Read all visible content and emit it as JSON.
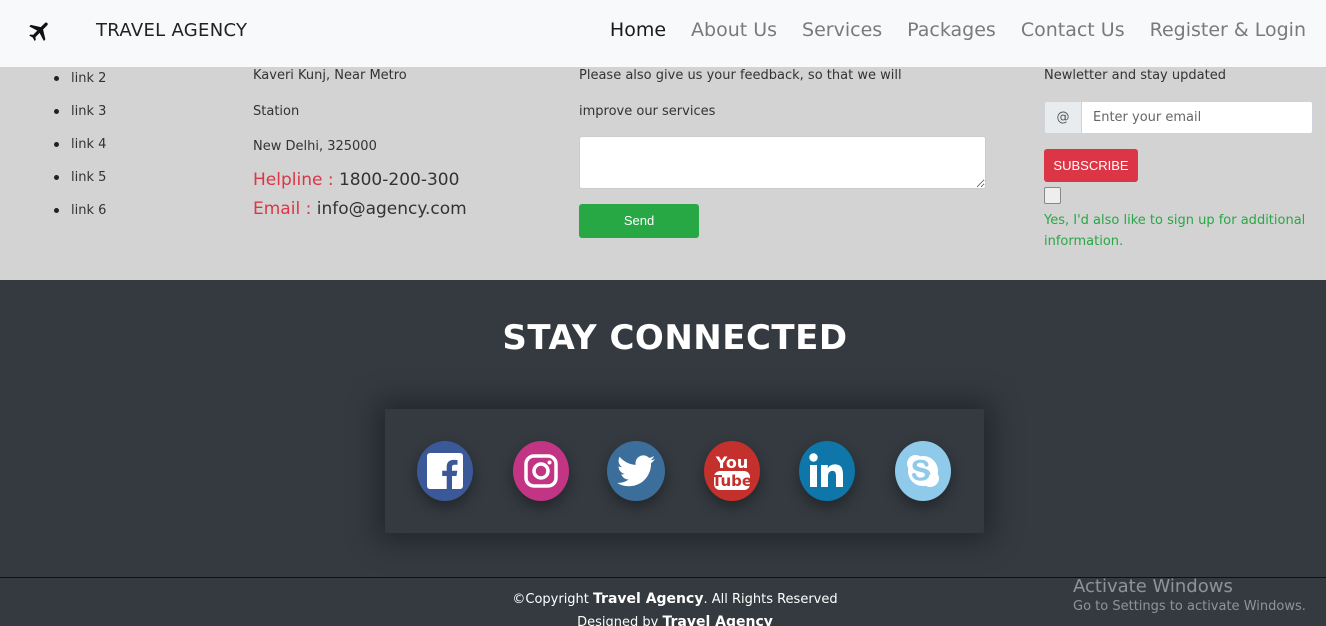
{
  "navbar": {
    "brand": "TRAVEL AGENCY",
    "brand_icon": "airplane-icon",
    "links": [
      {
        "label": "Home",
        "active": true
      },
      {
        "label": "About Us"
      },
      {
        "label": "Services"
      },
      {
        "label": "Packages"
      },
      {
        "label": "Contact Us"
      },
      {
        "label": "Register & Login"
      }
    ]
  },
  "quick_links": [
    "link 2",
    "link 3",
    "link 4",
    "link 5",
    "link 6"
  ],
  "address": {
    "line1": "Kaveri Kunj, Near Metro",
    "line2": "Station",
    "line3": "New Delhi, 325000",
    "helpline_label": "Helpline",
    "helpline_value": "1800-200-300",
    "email_label": "Email",
    "email_value": "info@agency.com",
    "separator": ":"
  },
  "feedback": {
    "line1": "Please also give us your feedback, so that we will",
    "line2": "improve our services",
    "send_label": "Send"
  },
  "newsletter": {
    "text": "Newletter and stay updated",
    "prepend": "@",
    "placeholder": "Enter your email",
    "subscribe_label": "SUBSCRIBE",
    "signup_note": "Yes, I'd also like to sign up for additional information."
  },
  "social": {
    "title": "STAY CONNECTED",
    "icons": [
      "facebook-icon",
      "instagram-icon",
      "twitter-icon",
      "youtube-icon",
      "linkedin-icon",
      "skype-icon"
    ],
    "colors": {
      "facebook": "#3b5998",
      "instagram": "#c13584",
      "twitter": "#3b6e9a",
      "youtube": "#c4302b",
      "linkedin": "#0e76a8",
      "skype": "#8fcaea"
    }
  },
  "footer": {
    "copyright_prefix": "©Copyright",
    "brand": "Travel Agency",
    "copyright_suffix": ". All Rights Reserved",
    "designed_prefix": "Designed by",
    "designed_brand": "Travel Agency"
  },
  "watermark": {
    "line1": "Activate Windows",
    "line2": "Go to Settings to activate Windows."
  },
  "colors": {
    "nav_bg": "#f8f9fa",
    "band_bg": "#d3d3d3",
    "dark_bg": "#343a40",
    "accent_red": "#dc3545",
    "accent_green": "#28a745"
  }
}
